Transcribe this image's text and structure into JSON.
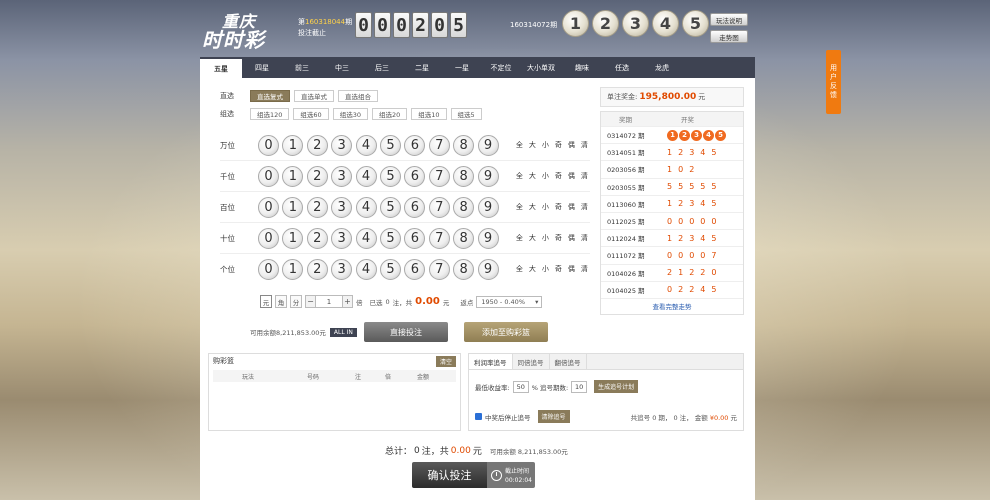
{
  "header": {
    "logo_line1": "重庆",
    "logo_line2": "时时彩",
    "issue_prefix": "第",
    "current_issue": "160318044",
    "issue_suffix": "期",
    "issue_status": "投注截止",
    "countdown": [
      "0",
      "0",
      "0",
      "2",
      "0",
      "5"
    ],
    "last_issue": "160314072期",
    "last_result": [
      "1",
      "2",
      "3",
      "4",
      "5"
    ],
    "rules_label": "玩法说明",
    "trend_label": "走势图"
  },
  "tabs": [
    "五星",
    "四星",
    "前三",
    "中三",
    "后三",
    "二星",
    "一星",
    "不定位",
    "大小单双",
    "趣味",
    "任选",
    "龙虎"
  ],
  "modes": {
    "direct_label": "直选",
    "direct": [
      "直选复式",
      "直选单式",
      "直选组合"
    ],
    "group_label": "组选",
    "group": [
      "组选120",
      "组选60",
      "组选30",
      "组选20",
      "组选10",
      "组选5"
    ]
  },
  "positions": [
    "万位",
    "千位",
    "百位",
    "十位",
    "个位"
  ],
  "numbers": [
    "0",
    "1",
    "2",
    "3",
    "4",
    "5",
    "6",
    "7",
    "8",
    "9"
  ],
  "quick_select": [
    "全",
    "大",
    "小",
    "奇",
    "偶",
    "清"
  ],
  "bet": {
    "units": [
      "元",
      "角",
      "分"
    ],
    "minus": "−",
    "multiple": "1",
    "plus": "+",
    "multiple_suffix": "倍",
    "selected_prefix": "已选",
    "selected_count": "0",
    "selected_unit": "注，共",
    "amount": "0.00",
    "amount_unit": "元",
    "rebate_label": "返点",
    "rebate_value": "1950 - 0.40%"
  },
  "balance": {
    "label": "可用余额8,211,853.00元",
    "allin": "ALL IN"
  },
  "actions": {
    "direct_bet": "直接投注",
    "add_cart": "添加至购彩篮"
  },
  "prize": {
    "label": "单注奖金:",
    "amount": "195,800.00",
    "unit": "元"
  },
  "history": {
    "col_issue": "奖期",
    "col_result": "开奖",
    "rows": [
      {
        "issue": "0314072 期",
        "nums": [
          "1",
          "2",
          "3",
          "4",
          "5"
        ]
      },
      {
        "issue": "0314051 期",
        "nums": [
          "1",
          "2",
          "3",
          "4",
          "5"
        ]
      },
      {
        "issue": "0203056 期",
        "nums": [
          "1",
          "0",
          "2"
        ]
      },
      {
        "issue": "0203055 期",
        "nums": [
          "5",
          "5",
          "5",
          "5",
          "5"
        ]
      },
      {
        "issue": "0113060 期",
        "nums": [
          "1",
          "2",
          "3",
          "4",
          "5"
        ]
      },
      {
        "issue": "0112025 期",
        "nums": [
          "0",
          "0",
          "0",
          "0",
          "0"
        ]
      },
      {
        "issue": "0112024 期",
        "nums": [
          "1",
          "2",
          "3",
          "4",
          "5"
        ]
      },
      {
        "issue": "0111072 期",
        "nums": [
          "0",
          "0",
          "0",
          "0",
          "7"
        ]
      },
      {
        "issue": "0104026 期",
        "nums": [
          "2",
          "1",
          "2",
          "2",
          "0"
        ]
      },
      {
        "issue": "0104025 期",
        "nums": [
          "0",
          "2",
          "2",
          "4",
          "5"
        ]
      }
    ],
    "more": "查看完整走势"
  },
  "cart": {
    "title": "购彩篮",
    "clear": "清空",
    "columns": [
      "玩法",
      "号码",
      "注",
      "倍",
      "金额"
    ]
  },
  "chase": {
    "tabs": [
      "利润率追号",
      "同倍追号",
      "翻倍追号"
    ],
    "min_rate_label": "最低收益率:",
    "min_rate": "50",
    "issues_label": "% 追号期数:",
    "issues": "10",
    "generate": "生成追号计划",
    "stop_label": "中奖后停止追号",
    "clear": "清除追号",
    "summary_prefix": "共追号 0 期， 0 注， 金额",
    "summary_amount": "¥0.00",
    "summary_unit": "元"
  },
  "total": {
    "prefix": "总计：",
    "count": "0",
    "mid": "注，共",
    "amount": "0.00",
    "unit": "元",
    "balance": "可用余额  8,211,853.00元"
  },
  "confirm": {
    "label": "确认投注",
    "deadline_label": "截止时间",
    "deadline_time": "00:02:04"
  },
  "feedback": "用户反馈"
}
